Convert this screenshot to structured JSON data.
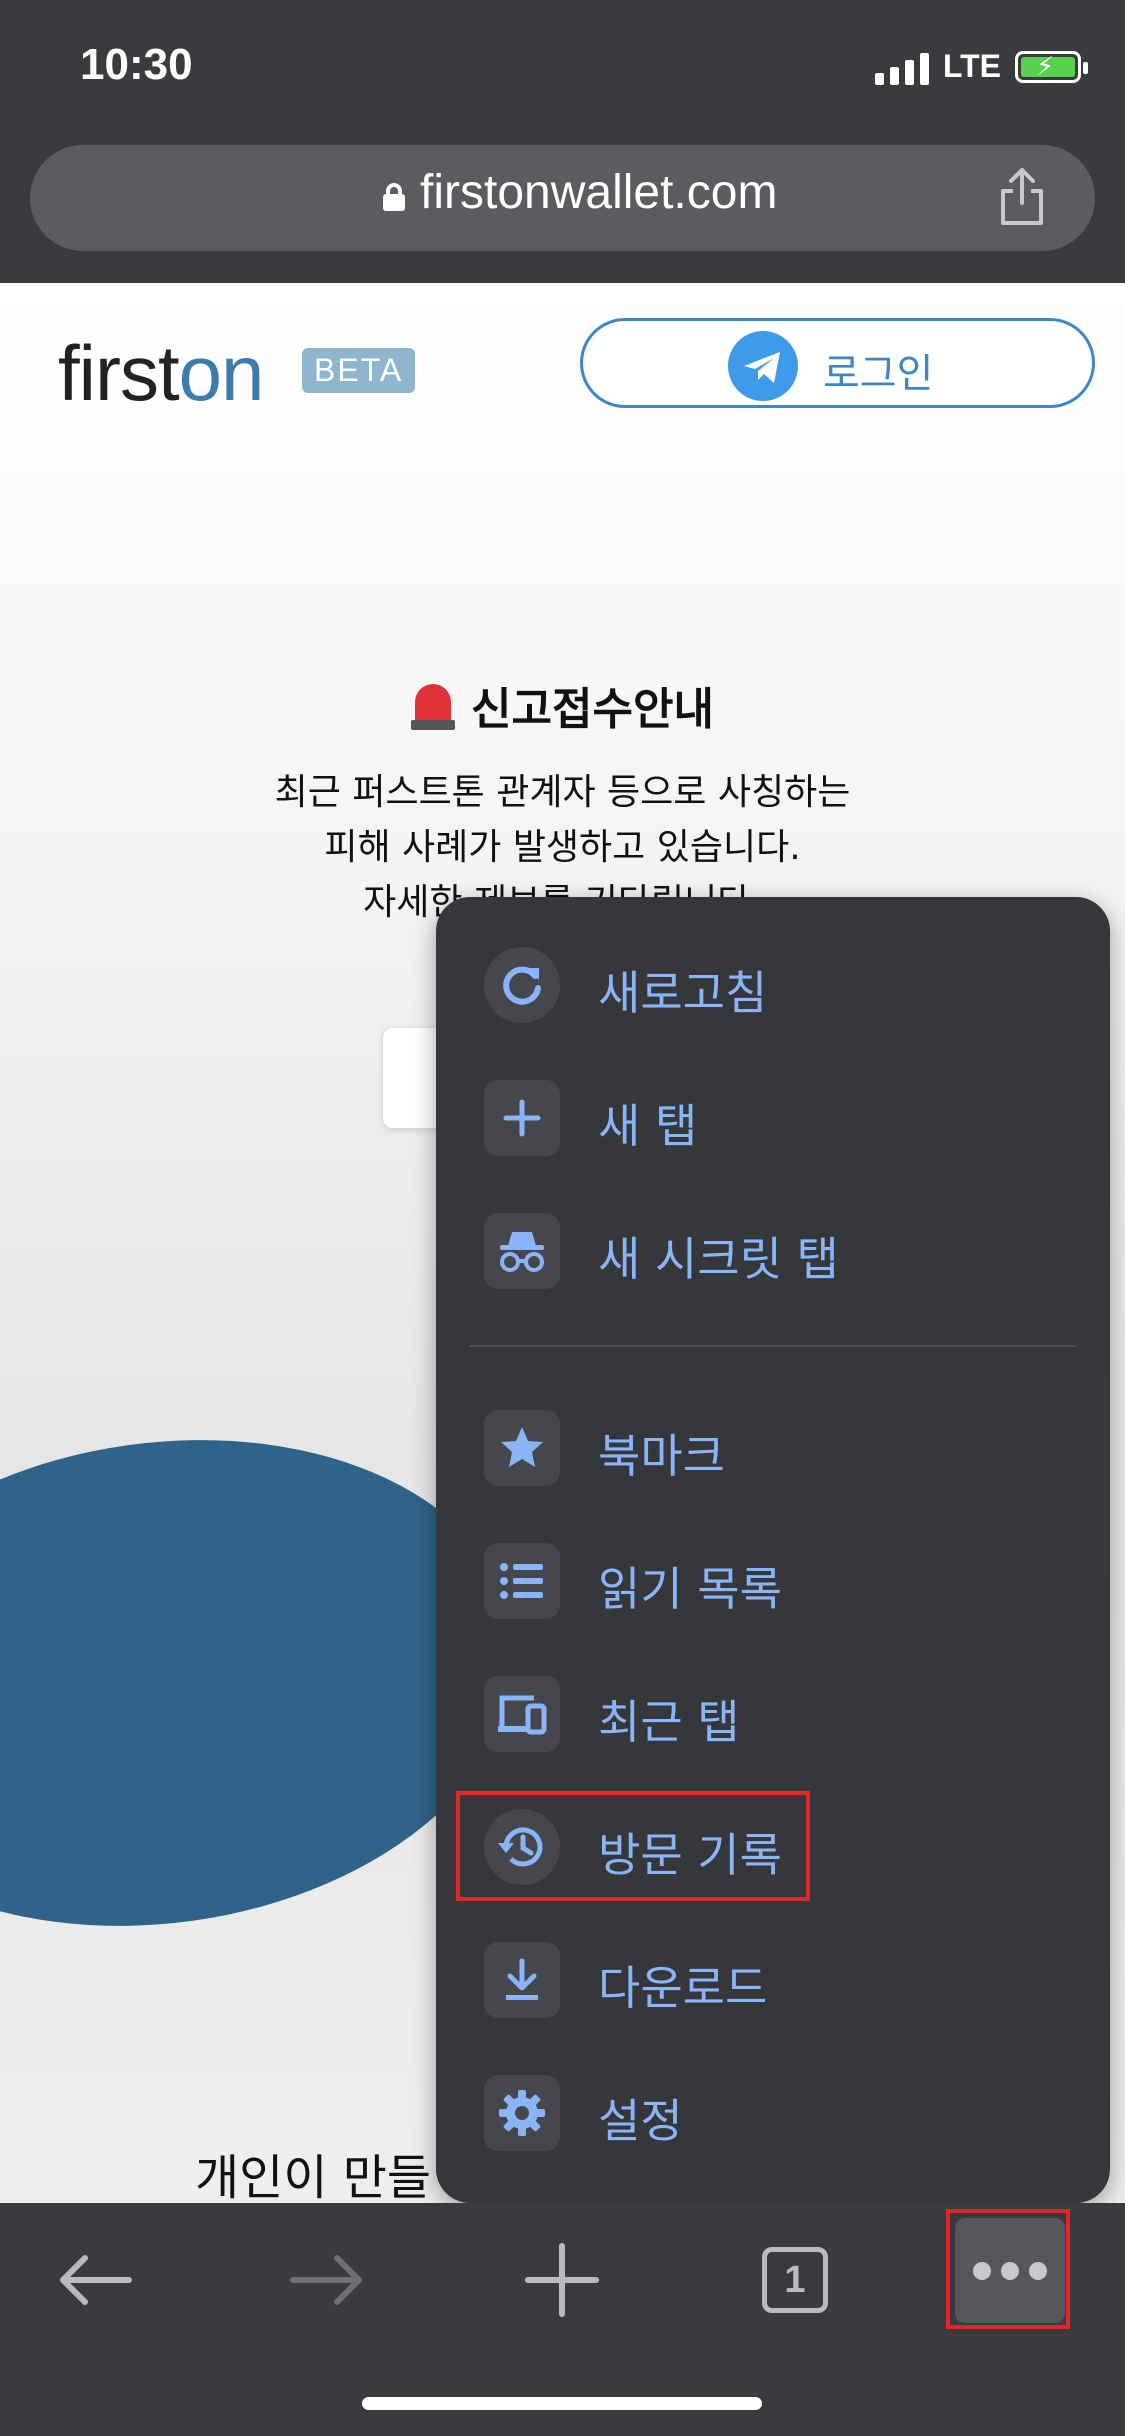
{
  "status_bar": {
    "time": "10:30",
    "network": "LTE"
  },
  "address_bar": {
    "url": "firstonwallet.com",
    "icons": [
      "lock-icon",
      "share-icon"
    ]
  },
  "site": {
    "logo": {
      "first": "first",
      "second": "on"
    },
    "badge": "BETA",
    "login_label": "로그인",
    "notice": {
      "title": "신고접수안내",
      "lines": [
        "최근 퍼스트톤 관계자 등으로 사칭하는",
        "피해 사례가 발생하고 있습니다.",
        "자세한 제보를 기다립니다."
      ]
    },
    "bottom_text": "개인이 만들"
  },
  "menu": {
    "items": [
      {
        "label": "새로고침",
        "icon": "reload-icon"
      },
      {
        "label": "새 탭",
        "icon": "plus-icon"
      },
      {
        "label": "새 시크릿 탭",
        "icon": "incognito-icon"
      },
      {
        "label": "북마크",
        "icon": "star-icon"
      },
      {
        "label": "읽기 목록",
        "icon": "list-icon"
      },
      {
        "label": "최근 탭",
        "icon": "devices-icon"
      },
      {
        "label": "방문 기록",
        "icon": "history-icon"
      },
      {
        "label": "다운로드",
        "icon": "download-icon"
      },
      {
        "label": "설정",
        "icon": "gear-icon"
      }
    ],
    "highlighted": "방문 기록"
  },
  "toolbar": {
    "tab_count": "1"
  },
  "colors": {
    "menu_bg": "#36373b",
    "menu_text": "#8ab4f8",
    "highlight": "#e0262b",
    "brand": "#3d7ca8"
  }
}
